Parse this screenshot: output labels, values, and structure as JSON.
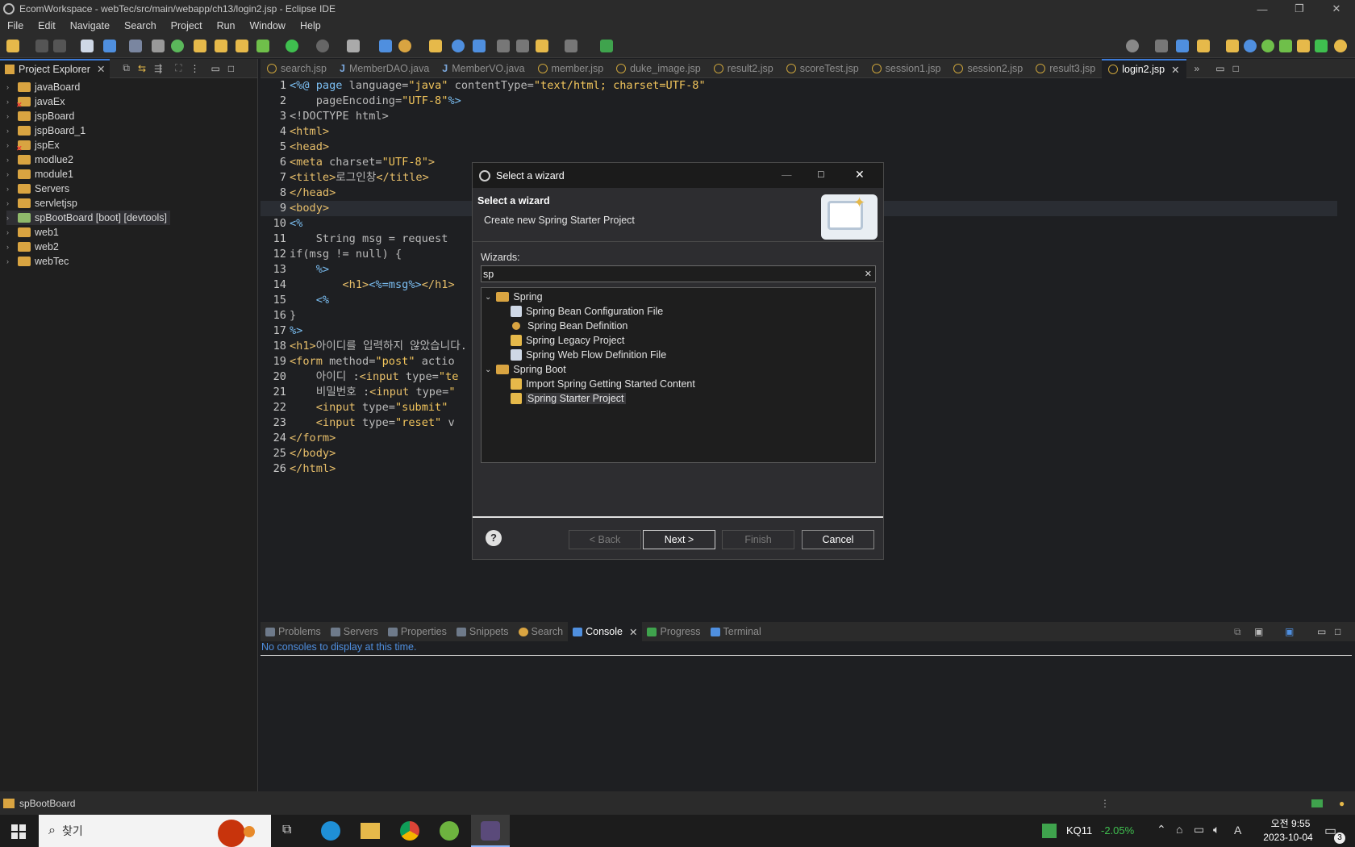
{
  "window": {
    "title": "EcomWorkspace - webTec/src/main/webapp/ch13/login2.jsp - Eclipse IDE"
  },
  "menu": [
    "File",
    "Edit",
    "Navigate",
    "Search",
    "Project",
    "Run",
    "Window",
    "Help"
  ],
  "explorer": {
    "tab_label": "Project Explorer",
    "items": [
      "javaBoard",
      "javaEx",
      "jspBoard",
      "jspBoard_1",
      "jspEx",
      "modlue2",
      "module1",
      "Servers",
      "servletjsp",
      "spBootBoard [boot] [devtools]",
      "web1",
      "web2",
      "webTec"
    ]
  },
  "editor": {
    "tabs": [
      "search.jsp",
      "MemberDAO.java",
      "MemberVO.java",
      "member.jsp",
      "duke_image.jsp",
      "result2.jsp",
      "scoreTest.jsp",
      "session1.jsp",
      "session2.jsp",
      "result3.jsp",
      "login2.jsp"
    ],
    "active_tab": "login2.jsp",
    "line_numbers": [
      "1",
      "2",
      "3",
      "4",
      "5",
      "6",
      "7",
      "8",
      "9",
      "10",
      "11",
      "12",
      "13",
      "14",
      "15",
      "16",
      "17",
      "18",
      "19",
      "20",
      "21",
      "22",
      "23",
      "24",
      "25",
      "26"
    ],
    "lines": [
      [
        "<%@ ",
        "page ",
        "language=",
        "\"java\" ",
        "contentType=",
        "\"text/html; charset=UTF-8\""
      ],
      [
        "    pageEncoding=",
        "\"UTF-8\"",
        "%>"
      ],
      [
        "<!DOCTYPE html>"
      ],
      [
        "<html>"
      ],
      [
        "<head>"
      ],
      [
        "<meta ",
        "charset=",
        "\"UTF-8\"",
        ">"
      ],
      [
        "<title>",
        "로그인창",
        "</title>"
      ],
      [
        "</head>"
      ],
      [
        "<body>"
      ],
      [
        "<%"
      ],
      [
        "    String msg = request"
      ],
      [
        "if(msg != null) {"
      ],
      [
        "    %>"
      ],
      [
        "        <h1>",
        "<%=msg%>",
        "</h1>"
      ],
      [
        "    <%"
      ],
      [
        "}"
      ],
      [
        "%>"
      ],
      [
        "<h1>",
        "아이디를 입력하지 않았습니다."
      ],
      [
        "<form ",
        "method=",
        "\"post\" ",
        "actio"
      ],
      [
        "    아이디 :",
        "<input ",
        "type=",
        "\"te"
      ],
      [
        "    비밀번호 :",
        "<input ",
        "type=",
        "\""
      ],
      [
        "    <input ",
        "type=",
        "\"submit\""
      ],
      [
        "    <input ",
        "type=",
        "\"reset\" ",
        "v"
      ],
      [
        "</form>"
      ],
      [
        "</body>"
      ],
      [
        "</html>"
      ]
    ]
  },
  "console": {
    "tabs": [
      "Problems",
      "Servers",
      "Properties",
      "Snippets",
      "Search",
      "Console",
      "Progress",
      "Terminal"
    ],
    "active_tab": "Console",
    "message": "No consoles to display at this time."
  },
  "status": {
    "selection": "spBootBoard"
  },
  "taskbar": {
    "search_text": "찾기",
    "stock": "KQ11",
    "stock_change": "-2.05%",
    "time": "오전 9:55",
    "date": "2023-10-04",
    "ime": "A",
    "notif_count": "3"
  },
  "dialog": {
    "title": "Select a wizard",
    "heading": "Select a wizard",
    "description": "Create new Spring Starter Project",
    "wizards_label": "Wizards:",
    "filter_value": "sp",
    "groups": [
      {
        "label": "Spring",
        "items": [
          "Spring Bean Configuration File",
          "Spring Bean Definition",
          "Spring Legacy Project",
          "Spring Web Flow Definition File"
        ]
      },
      {
        "label": "Spring Boot",
        "items": [
          "Import Spring Getting Started Content",
          "Spring Starter Project"
        ]
      }
    ],
    "selected_item": "Spring Starter Project",
    "buttons": {
      "back": "< Back",
      "next": "Next >",
      "finish": "Finish",
      "cancel": "Cancel"
    },
    "help": "?"
  },
  "colors": {
    "accent": "#3c7ad6",
    "folder": "#d9a441",
    "string": "#f2c55c",
    "tag": "#e8bf6a",
    "stock_negative": "#3fbf4f"
  }
}
